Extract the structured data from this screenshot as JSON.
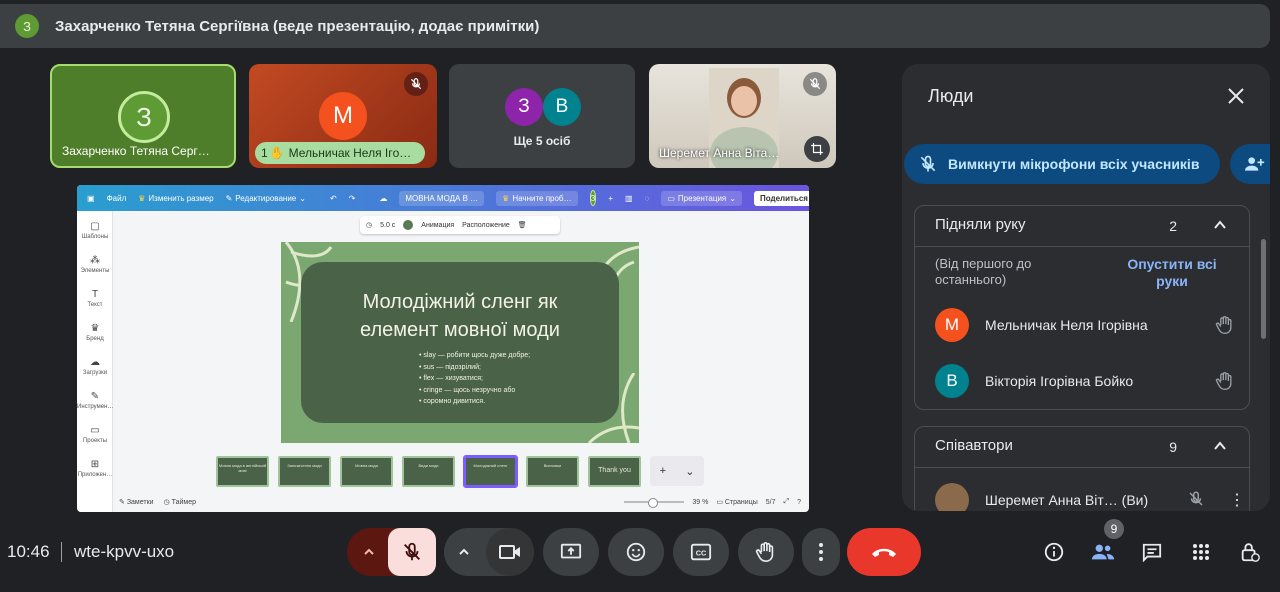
{
  "presenter_bar": {
    "avatar_letter": "З",
    "text": "Захарченко Тетяна Сергіївна (веде презентацію, додає примітки)"
  },
  "tiles": [
    {
      "avatar_letter": "З",
      "label": "Захарченко Тетяна Серг…",
      "color": "#5e9b34"
    },
    {
      "avatar_letter": "М",
      "hand_order": "1",
      "label": "Мельничак Неля Ігo…",
      "color": "#f4511e"
    },
    {
      "avatar_letters": [
        "З",
        "В"
      ],
      "label": "Ще 5 осіб"
    },
    {
      "label": "Шеремет Анна Віта…"
    }
  ],
  "canva": {
    "toolbar": {
      "file": "Файл",
      "resize": "Изменить размер",
      "edit": "Редактирование",
      "doc_title": "МОВНА МОДА В …",
      "try_pro": "Начните проб…",
      "collab_letter": "З",
      "present": "Презентация",
      "share": "Поделиться"
    },
    "sidebar": [
      "Шаблоны",
      "Элементы",
      "Текст",
      "Бренд",
      "Загрузки",
      "Инструмен…",
      "Проекты",
      "Приложен…"
    ],
    "subtoolbar": {
      "duration": "5.0 с",
      "animation": "Анимация",
      "position": "Расположение"
    },
    "slide": {
      "title_line1": "Молодіжний сленг як",
      "title_line2": "елемент мовної моди",
      "bullets": [
        "slay — робити щось дуже добре;",
        "sus — підозрілий;",
        "flex — хизуватися;",
        "cringe — щось незручно або",
        "соромно дивитися."
      ]
    },
    "thumbs": [
      "Мовна мода в англійській мові",
      "Запозичення моди",
      "Мовна мода",
      "Види моди",
      "Молодіжний сленг",
      "Висновки",
      "Thank you"
    ],
    "bottom": {
      "notes": "Заметки",
      "timer": "Таймер",
      "zoom": "39 %",
      "pages": "Страницы",
      "page_count": "5/7"
    }
  },
  "people_panel": {
    "title": "Люди",
    "mute_all": "Вимкнути мікрофони всіх учасників",
    "raised_hands": {
      "header": "Підняли руку",
      "count": "2",
      "order_note": "(Від першого до останнього)",
      "lower_all": "Опустити всі руки",
      "people": [
        {
          "letter": "М",
          "name": "Мельничак Неля Ігорівна",
          "color": "#f4511e"
        },
        {
          "letter": "В",
          "name": "Вікторія Ігорівна Бойко",
          "color": "#00838f"
        }
      ]
    },
    "coauthors": {
      "header": "Співавтори",
      "count": "9",
      "first_name": "Шеремет Анна Віт…",
      "first_suffix": "(Ви)"
    }
  },
  "bottom_bar": {
    "time": "10:46",
    "meeting_code": "wte-kpvv-uxo",
    "participants_badge": "9"
  }
}
